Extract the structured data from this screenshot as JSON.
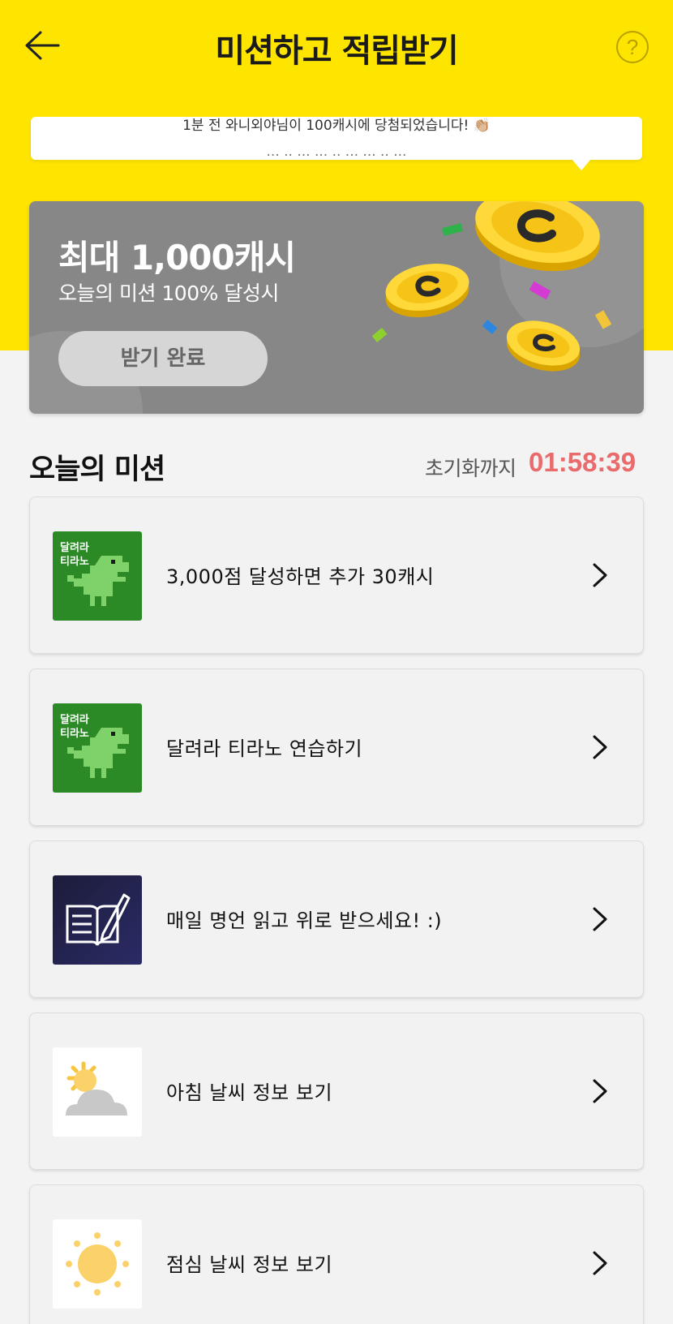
{
  "header": {
    "title": "미션하고 적립받기",
    "help_symbol": "?"
  },
  "ticker": {
    "line1": "1분 전 와니외야님이 100캐시에 당첨되었습니다! 👏🏼",
    "line2": "··· ·· ··· ··· ·· ··· ··· ·· ···"
  },
  "reward": {
    "title": "최대 1,000캐시",
    "subtitle": "오늘의 미션 100% 달성시",
    "button_label": "받기 완료"
  },
  "missions_section": {
    "title": "오늘의 미션",
    "reset_label": "초기화까지",
    "reset_time": "01:58:39"
  },
  "missions": [
    {
      "label": "3,000점 달성하면 추가 30캐시",
      "thumb_text_1": "달려라",
      "thumb_text_2": "티라노",
      "icon": "dino-game-icon"
    },
    {
      "label": "달려라 티라노 연습하기",
      "thumb_text_1": "달려라",
      "thumb_text_2": "티라노",
      "icon": "dino-game-icon"
    },
    {
      "label": "매일 명언 읽고 위로 받으세요! :)",
      "icon": "book-pen-icon"
    },
    {
      "label": "아침 날씨 정보 보기",
      "icon": "sun-cloud-icon"
    },
    {
      "label": "점심 날씨 정보 보기",
      "icon": "sun-icon"
    }
  ],
  "colors": {
    "header_bg": "#fee500",
    "reward_card_bg": "#878787",
    "timer_red": "#e96b6b",
    "dino_green": "#2b8a26"
  }
}
